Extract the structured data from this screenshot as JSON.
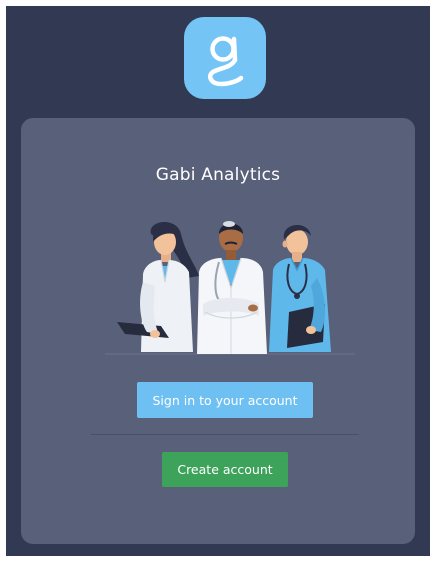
{
  "app": {
    "title": "Gabi Analytics",
    "logo_icon": "gabi-g-logo-icon",
    "illustration": "healthcare-team-illustration"
  },
  "actions": {
    "sign_in_label": "Sign in to your account",
    "create_account_label": "Create account"
  },
  "colors": {
    "background": "#313a52",
    "card": "#596079",
    "logo_tile": "#74c5f5",
    "sign_in_button": "#6fc0f2",
    "create_button": "#3da35a",
    "text": "#ffffff"
  }
}
